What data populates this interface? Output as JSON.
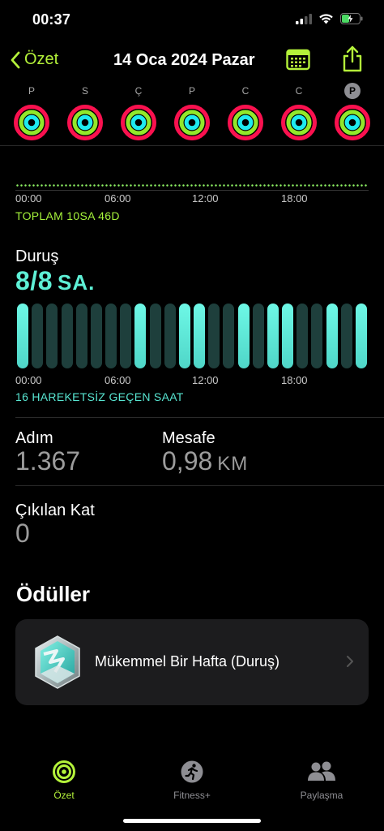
{
  "status_bar": {
    "time": "00:37"
  },
  "nav": {
    "back_label": "Özet",
    "title": "14 Oca 2024 Pazar"
  },
  "week": {
    "days": [
      {
        "letter": "P",
        "selected": false
      },
      {
        "letter": "S",
        "selected": false
      },
      {
        "letter": "Ç",
        "selected": false
      },
      {
        "letter": "P",
        "selected": false
      },
      {
        "letter": "C",
        "selected": false
      },
      {
        "letter": "C",
        "selected": false
      },
      {
        "letter": "P",
        "selected": true
      }
    ]
  },
  "exercise": {
    "axis_ticks": [
      "00:00",
      "06:00",
      "12:00",
      "18:00"
    ],
    "total_label": "TOPLAM 10SA 46D"
  },
  "stand": {
    "label": "Duruş",
    "value": "8/8",
    "unit": "SA.",
    "axis_ticks": [
      "00:00",
      "06:00",
      "12:00",
      "18:00"
    ],
    "idle_label": "16 HAREKETSİZ GEÇEN SAAT",
    "hours": [
      1,
      0,
      0,
      0,
      0,
      0,
      0,
      0,
      1,
      0,
      0,
      1,
      1,
      0,
      0,
      1,
      0,
      1,
      1,
      0,
      0,
      1,
      0,
      1
    ],
    "colors": {
      "active": "#5ef0d6",
      "inactive": "#1e3f3c"
    }
  },
  "metrics": {
    "steps_label": "Adım",
    "steps_value": "1.367",
    "distance_label": "Mesafe",
    "distance_value": "0,98",
    "distance_unit": "KM",
    "floors_label": "Çıkılan Kat",
    "floors_value": "0"
  },
  "awards": {
    "title": "Ödüller",
    "items": [
      {
        "name": "Mükemmel Bir Hafta (Duruş)"
      }
    ]
  },
  "tab_bar": {
    "tabs": [
      {
        "label": "Özet",
        "icon": "rings-icon",
        "active": true
      },
      {
        "label": "Fitness+",
        "icon": "runner-icon",
        "active": false
      },
      {
        "label": "Paylaşma",
        "icon": "people-icon",
        "active": false
      }
    ]
  },
  "colors": {
    "accent": "#b4f23a",
    "move_ring": "#fa114f",
    "exercise_ring": "#92e82a",
    "stand_ring": "#1eeaef"
  }
}
